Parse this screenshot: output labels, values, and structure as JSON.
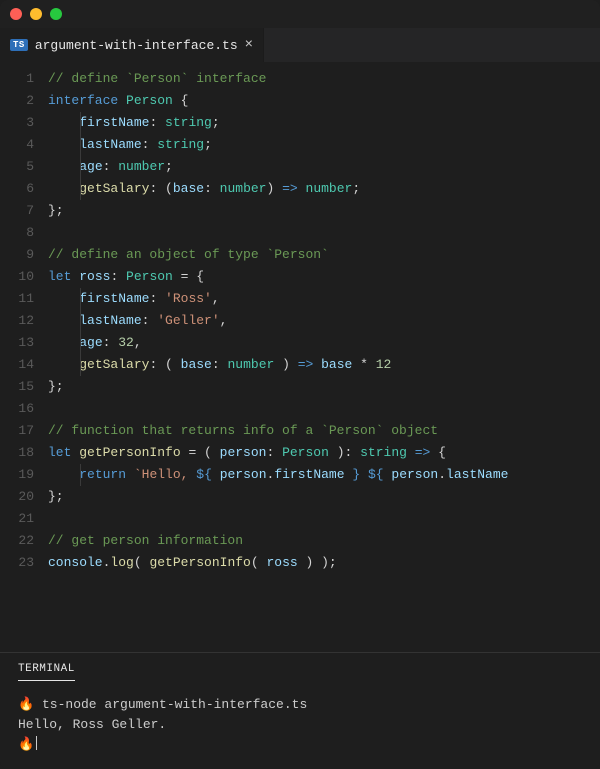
{
  "tab": {
    "icon": "TS",
    "filename": "argument-with-interface.ts"
  },
  "lineCount": 23,
  "code": {
    "l1": [
      {
        "t": "// define `Person` interface",
        "c": "c-comment"
      }
    ],
    "l2": [
      {
        "t": "interface ",
        "c": "c-kw"
      },
      {
        "t": "Person",
        "c": "c-type"
      },
      {
        "t": " {",
        "c": "c-punc"
      }
    ],
    "l3": [
      {
        "t": "firstName",
        "c": "c-prop"
      },
      {
        "t": ": ",
        "c": "c-punc"
      },
      {
        "t": "string",
        "c": "c-type"
      },
      {
        "t": ";",
        "c": "c-punc"
      }
    ],
    "l4": [
      {
        "t": "lastName",
        "c": "c-prop"
      },
      {
        "t": ": ",
        "c": "c-punc"
      },
      {
        "t": "string",
        "c": "c-type"
      },
      {
        "t": ";",
        "c": "c-punc"
      }
    ],
    "l5": [
      {
        "t": "age",
        "c": "c-prop"
      },
      {
        "t": ": ",
        "c": "c-punc"
      },
      {
        "t": "number",
        "c": "c-type"
      },
      {
        "t": ";",
        "c": "c-punc"
      }
    ],
    "l6": [
      {
        "t": "getSalary",
        "c": "c-fn"
      },
      {
        "t": ": (",
        "c": "c-punc"
      },
      {
        "t": "base",
        "c": "c-prop"
      },
      {
        "t": ": ",
        "c": "c-punc"
      },
      {
        "t": "number",
        "c": "c-type"
      },
      {
        "t": ") ",
        "c": "c-punc"
      },
      {
        "t": "=>",
        "c": "c-kw"
      },
      {
        "t": " ",
        "c": "c-punc"
      },
      {
        "t": "number",
        "c": "c-type"
      },
      {
        "t": ";",
        "c": "c-punc"
      }
    ],
    "l7": [
      {
        "t": "};",
        "c": "c-punc"
      }
    ],
    "l8": [],
    "l9": [
      {
        "t": "// define an object of type `Person`",
        "c": "c-comment"
      }
    ],
    "l10": [
      {
        "t": "let",
        "c": "c-kw"
      },
      {
        "t": " ",
        "c": "c-punc"
      },
      {
        "t": "ross",
        "c": "c-prop"
      },
      {
        "t": ": ",
        "c": "c-punc"
      },
      {
        "t": "Person",
        "c": "c-type"
      },
      {
        "t": " = {",
        "c": "c-punc"
      }
    ],
    "l11": [
      {
        "t": "firstName",
        "c": "c-prop"
      },
      {
        "t": ": ",
        "c": "c-punc"
      },
      {
        "t": "'Ross'",
        "c": "c-str"
      },
      {
        "t": ",",
        "c": "c-punc"
      }
    ],
    "l12": [
      {
        "t": "lastName",
        "c": "c-prop"
      },
      {
        "t": ": ",
        "c": "c-punc"
      },
      {
        "t": "'Geller'",
        "c": "c-str"
      },
      {
        "t": ",",
        "c": "c-punc"
      }
    ],
    "l13": [
      {
        "t": "age",
        "c": "c-prop"
      },
      {
        "t": ": ",
        "c": "c-punc"
      },
      {
        "t": "32",
        "c": "c-num"
      },
      {
        "t": ",",
        "c": "c-punc"
      }
    ],
    "l14": [
      {
        "t": "getSalary",
        "c": "c-fn"
      },
      {
        "t": ": ( ",
        "c": "c-punc"
      },
      {
        "t": "base",
        "c": "c-prop"
      },
      {
        "t": ": ",
        "c": "c-punc"
      },
      {
        "t": "number",
        "c": "c-type"
      },
      {
        "t": " ) ",
        "c": "c-punc"
      },
      {
        "t": "=>",
        "c": "c-kw"
      },
      {
        "t": " ",
        "c": "c-punc"
      },
      {
        "t": "base",
        "c": "c-prop"
      },
      {
        "t": " * ",
        "c": "c-punc"
      },
      {
        "t": "12",
        "c": "c-num"
      }
    ],
    "l15": [
      {
        "t": "};",
        "c": "c-punc"
      }
    ],
    "l16": [],
    "l17": [
      {
        "t": "// function that returns info of a `Person` object",
        "c": "c-comment"
      }
    ],
    "l18": [
      {
        "t": "let",
        "c": "c-kw"
      },
      {
        "t": " ",
        "c": "c-punc"
      },
      {
        "t": "getPersonInfo",
        "c": "c-fn"
      },
      {
        "t": " = ( ",
        "c": "c-punc"
      },
      {
        "t": "person",
        "c": "c-prop"
      },
      {
        "t": ": ",
        "c": "c-punc"
      },
      {
        "t": "Person",
        "c": "c-type"
      },
      {
        "t": " ): ",
        "c": "c-punc"
      },
      {
        "t": "string",
        "c": "c-type"
      },
      {
        "t": " ",
        "c": "c-punc"
      },
      {
        "t": "=>",
        "c": "c-kw"
      },
      {
        "t": " {",
        "c": "c-punc"
      }
    ],
    "l19": [
      {
        "t": "return",
        "c": "c-kw"
      },
      {
        "t": " ",
        "c": "c-punc"
      },
      {
        "t": "`Hello, ",
        "c": "c-str"
      },
      {
        "t": "${",
        "c": "c-kw"
      },
      {
        "t": " ",
        "c": "c-punc"
      },
      {
        "t": "person",
        "c": "c-prop"
      },
      {
        "t": ".",
        "c": "c-punc"
      },
      {
        "t": "firstName",
        "c": "c-prop"
      },
      {
        "t": " ",
        "c": "c-punc"
      },
      {
        "t": "}",
        "c": "c-kw"
      },
      {
        "t": " ",
        "c": "c-str"
      },
      {
        "t": "${",
        "c": "c-kw"
      },
      {
        "t": " ",
        "c": "c-punc"
      },
      {
        "t": "person",
        "c": "c-prop"
      },
      {
        "t": ".",
        "c": "c-punc"
      },
      {
        "t": "lastName",
        "c": "c-prop"
      }
    ],
    "l20": [
      {
        "t": "};",
        "c": "c-punc"
      }
    ],
    "l21": [],
    "l22": [
      {
        "t": "// get person information",
        "c": "c-comment"
      }
    ],
    "l23": [
      {
        "t": "console",
        "c": "c-prop"
      },
      {
        "t": ".",
        "c": "c-punc"
      },
      {
        "t": "log",
        "c": "c-fn"
      },
      {
        "t": "( ",
        "c": "c-punc"
      },
      {
        "t": "getPersonInfo",
        "c": "c-fn"
      },
      {
        "t": "( ",
        "c": "c-punc"
      },
      {
        "t": "ross",
        "c": "c-prop"
      },
      {
        "t": " ) );",
        "c": "c-punc"
      }
    ]
  },
  "indents": {
    "l1": 0,
    "l2": 0,
    "l3": 1,
    "l4": 1,
    "l5": 1,
    "l6": 1,
    "l7": 0,
    "l8": 0,
    "l9": 0,
    "l10": 0,
    "l11": 1,
    "l12": 1,
    "l13": 1,
    "l14": 1,
    "l15": 0,
    "l16": 0,
    "l17": 0,
    "l18": 0,
    "l19": 1,
    "l20": 0,
    "l21": 0,
    "l22": 0,
    "l23": 0
  },
  "panel": {
    "tab": "TERMINAL"
  },
  "terminal": {
    "prompt": "🔥",
    "line1_cmd": "ts-node argument-with-interface.ts",
    "line2": "Hello, Ross Geller."
  }
}
